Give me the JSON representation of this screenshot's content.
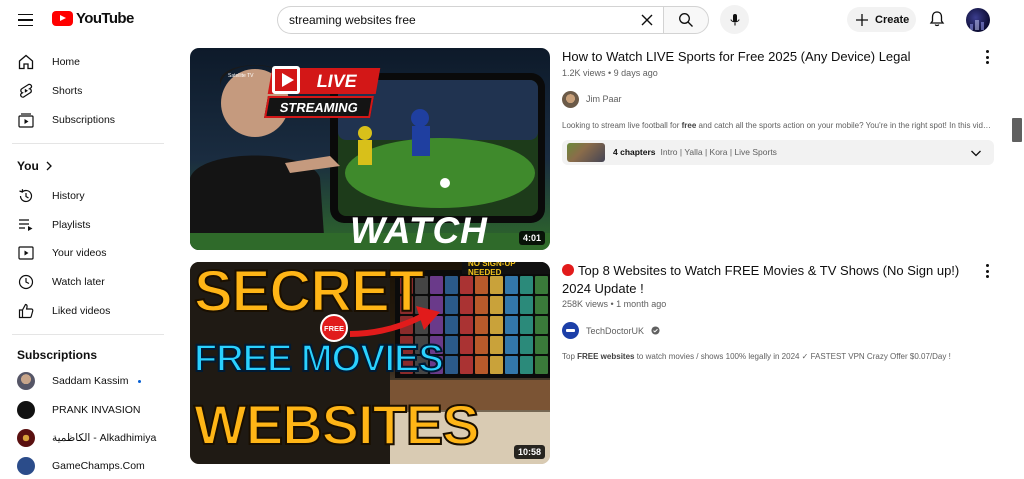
{
  "header": {
    "logo_text": "YouTube",
    "search_query": "streaming websites free",
    "create_label": "Create"
  },
  "sidebar": {
    "main": [
      {
        "label": "Home",
        "icon": "home-icon"
      },
      {
        "label": "Shorts",
        "icon": "shorts-icon"
      },
      {
        "label": "Subscriptions",
        "icon": "subscriptions-icon"
      }
    ],
    "you_heading": "You",
    "you_items": [
      {
        "label": "History",
        "icon": "history-icon"
      },
      {
        "label": "Playlists",
        "icon": "playlists-icon"
      },
      {
        "label": "Your videos",
        "icon": "your-videos-icon"
      },
      {
        "label": "Watch later",
        "icon": "watch-later-icon"
      },
      {
        "label": "Liked videos",
        "icon": "liked-videos-icon"
      }
    ],
    "subscriptions_heading": "Subscriptions",
    "subscriptions": [
      {
        "label": "Saddam Kassim",
        "new": true
      },
      {
        "label": "PRANK INVASION"
      },
      {
        "label": "الكاظمية - Alkadhimiya"
      },
      {
        "label": "GameChamps.Com"
      }
    ]
  },
  "results": [
    {
      "title": "How to Watch LIVE Sports for Free 2025 (Any Device) Legal",
      "meta": "1.2K views • 9 days ago",
      "channel": "Jim Paar",
      "desc_before": "Looking to stream live football for ",
      "desc_bold": "free",
      "desc_after": " and catch all the sports action on your mobile? You're in the right spot! In this video, I'll show you",
      "chapters_count": "4 chapters",
      "chapters_list": "Intro | Yalla | Kora | Live Sports",
      "duration": "4:01",
      "thumb_text": {
        "live": "LIVE",
        "streaming": "STREAMING",
        "watch": "WATCH",
        "tag": "Satellite TV"
      }
    },
    {
      "title_line1": "Top 8 Websites to Watch FREE Movies & TV Shows (No Sign up!)",
      "title_line2": "2024 Update !",
      "meta": "258K views • 1 month ago",
      "channel": "TechDoctorUK",
      "desc_before": "Top ",
      "desc_bold": "FREE websites",
      "desc_after": " to watch movies / shows 100% legally in 2024 ✓ FASTEST VPN Crazy Offer $0.07/Day !",
      "duration": "10:58",
      "thumb_text": {
        "secret": "SECRET",
        "free_movies": "FREE MOVIES",
        "websites": "WEBSITES",
        "free_badge": "FREE",
        "no_signup": "NO SIGN-UP NEEDED"
      }
    }
  ]
}
